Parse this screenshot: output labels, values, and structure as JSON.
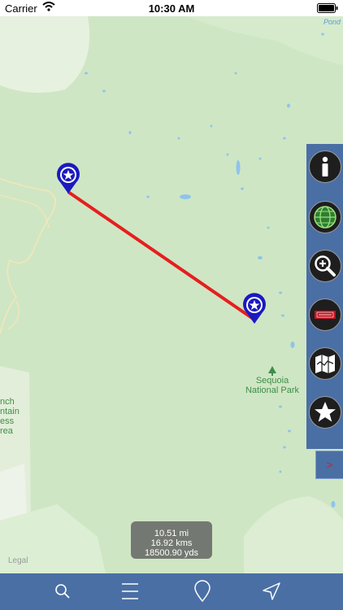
{
  "status_bar": {
    "carrier": "Carrier",
    "time": "10:30 AM"
  },
  "map": {
    "pond_label": "Pond",
    "park_label_line1": "Sequoia",
    "park_label_line2": "National Park",
    "wilderness_label_line1": "nch",
    "wilderness_label_line2": "ntain",
    "wilderness_label_line3": "ess",
    "wilderness_label_line4": "rea",
    "legal_label": "Legal",
    "route_color": "#e51f1f",
    "pin_color": "#1a1ac0"
  },
  "distance": {
    "miles": "10.51 mi",
    "kms": "16.92 kms",
    "yards": "18500.90 yds"
  },
  "side_panel": {
    "buttons": [
      "info-icon",
      "globe-icon",
      "zoom-in-icon",
      "map-style-icon",
      "folded-map-icon",
      "star-icon"
    ],
    "toggle_label": ">"
  },
  "tab_bar": {
    "items": [
      "search-icon",
      "menu-icon",
      "location-pin-icon",
      "navigation-arrow-icon"
    ]
  },
  "colors": {
    "panel": "#4a6fa5",
    "map_green": "#cfe6c4",
    "water": "#8ec4ec"
  }
}
